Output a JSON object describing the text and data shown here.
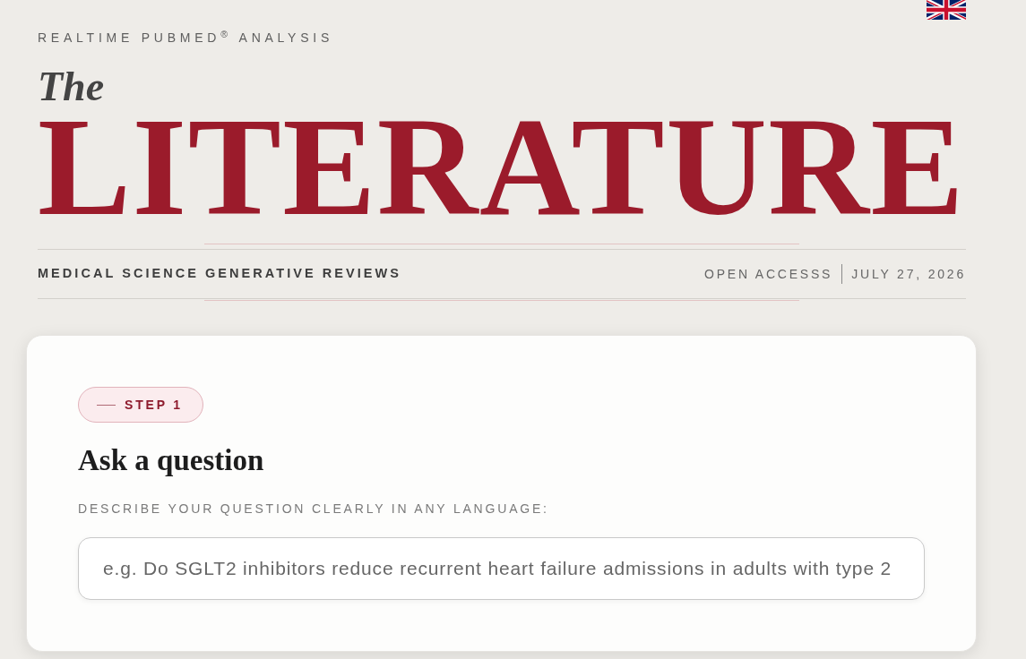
{
  "header": {
    "kicker": "REALTIME PUBMED$^{®}$ ANALYSIS",
    "title_prefix": "The",
    "title": "LITERATURE"
  },
  "masthead_bar": {
    "section": "MEDICAL SCIENCE GENERATIVE REVIEWS",
    "access": "OPEN ACCESSS",
    "date": "JULY 27, 2026"
  },
  "question_card": {
    "step_badge": "STEP 1",
    "heading": "Ask a question",
    "field_label": "DESCRIBE YOUR QUESTION CLEARLY IN ANY LANGUAGE:",
    "question_field": {
      "placeholder": "e.g. Do SGLT2 inhibitors reduce recurrent heart failure admissions in adults with type 2"
    }
  }
}
